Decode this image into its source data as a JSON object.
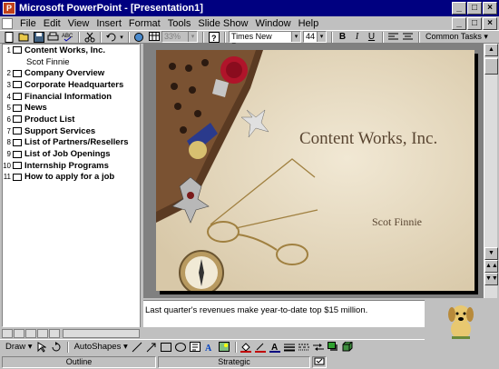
{
  "window": {
    "title": "Microsoft PowerPoint - [Presentation1]",
    "controls": [
      "_",
      "□",
      "×"
    ]
  },
  "menu": {
    "items": [
      {
        "label": "File",
        "mnemonic": "F"
      },
      {
        "label": "Edit",
        "mnemonic": "E"
      },
      {
        "label": "View",
        "mnemonic": "V"
      },
      {
        "label": "Insert",
        "mnemonic": "I"
      },
      {
        "label": "Format",
        "mnemonic": "o"
      },
      {
        "label": "Tools",
        "mnemonic": "T"
      },
      {
        "label": "Slide Show",
        "mnemonic": "d"
      },
      {
        "label": "Window",
        "mnemonic": "W"
      },
      {
        "label": "Help",
        "mnemonic": "H"
      }
    ]
  },
  "toolbar": {
    "zoom_value": "33%",
    "font_name": "Times New Roman",
    "font_size": "44",
    "bold": "B",
    "italic": "I",
    "underline": "U",
    "common_tasks": "Common Tasks ▾",
    "icons": [
      "new-icon",
      "open-icon",
      "save-icon",
      "print-icon",
      "spelling-icon",
      "cut-icon",
      "undo-icon",
      "hyperlink-icon",
      "zoom-icon",
      "help-icon",
      "align-left-icon",
      "center-icon"
    ]
  },
  "outline": {
    "slides": [
      {
        "num": "1",
        "title": "Content Works, Inc.",
        "sub": "Scot Finnie"
      },
      {
        "num": "2",
        "title": "Company Overview"
      },
      {
        "num": "3",
        "title": "Corporate Headquarters"
      },
      {
        "num": "4",
        "title": "Financial Information"
      },
      {
        "num": "5",
        "title": "News"
      },
      {
        "num": "6",
        "title": "Product List"
      },
      {
        "num": "7",
        "title": "Support Services"
      },
      {
        "num": "8",
        "title": "List of Partners/Resellers"
      },
      {
        "num": "9",
        "title": "List of Job Openings"
      },
      {
        "num": "10",
        "title": "Internship Programs"
      },
      {
        "num": "11",
        "title": "How to apply for a job"
      }
    ]
  },
  "slide": {
    "title": "Content Works, Inc.",
    "subtitle": "Scot Finnie",
    "text_color": "#5a4632",
    "background": "#e7ddc6"
  },
  "notes": {
    "text": "Last quarter's revenues make year-to-date top $15 million."
  },
  "drawing": {
    "draw_label": "Draw ▾",
    "autoshapes_label": "AutoShapes ▾"
  },
  "status": {
    "view": "Outline",
    "design": "Strategic"
  }
}
